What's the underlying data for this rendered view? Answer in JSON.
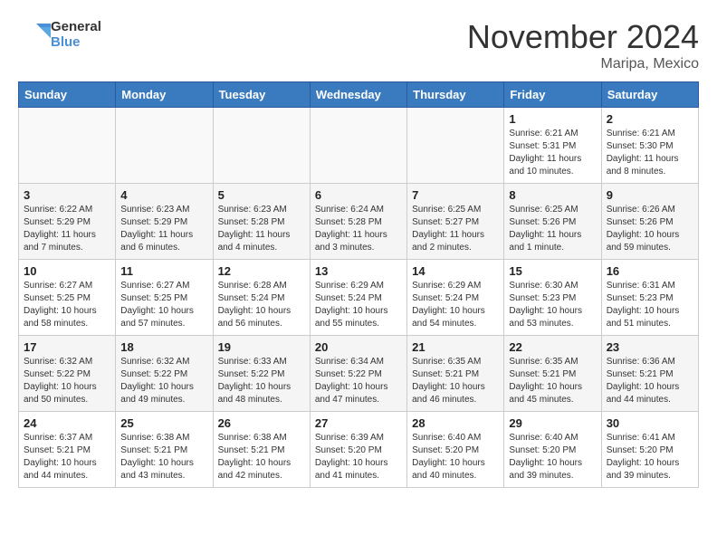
{
  "logo": {
    "line1": "General",
    "line2": "Blue"
  },
  "title": "November 2024",
  "location": "Maripa, Mexico",
  "weekdays": [
    "Sunday",
    "Monday",
    "Tuesday",
    "Wednesday",
    "Thursday",
    "Friday",
    "Saturday"
  ],
  "weeks": [
    [
      {
        "day": "",
        "info": ""
      },
      {
        "day": "",
        "info": ""
      },
      {
        "day": "",
        "info": ""
      },
      {
        "day": "",
        "info": ""
      },
      {
        "day": "",
        "info": ""
      },
      {
        "day": "1",
        "info": "Sunrise: 6:21 AM\nSunset: 5:31 PM\nDaylight: 11 hours and 10 minutes."
      },
      {
        "day": "2",
        "info": "Sunrise: 6:21 AM\nSunset: 5:30 PM\nDaylight: 11 hours and 8 minutes."
      }
    ],
    [
      {
        "day": "3",
        "info": "Sunrise: 6:22 AM\nSunset: 5:29 PM\nDaylight: 11 hours and 7 minutes."
      },
      {
        "day": "4",
        "info": "Sunrise: 6:23 AM\nSunset: 5:29 PM\nDaylight: 11 hours and 6 minutes."
      },
      {
        "day": "5",
        "info": "Sunrise: 6:23 AM\nSunset: 5:28 PM\nDaylight: 11 hours and 4 minutes."
      },
      {
        "day": "6",
        "info": "Sunrise: 6:24 AM\nSunset: 5:28 PM\nDaylight: 11 hours and 3 minutes."
      },
      {
        "day": "7",
        "info": "Sunrise: 6:25 AM\nSunset: 5:27 PM\nDaylight: 11 hours and 2 minutes."
      },
      {
        "day": "8",
        "info": "Sunrise: 6:25 AM\nSunset: 5:26 PM\nDaylight: 11 hours and 1 minute."
      },
      {
        "day": "9",
        "info": "Sunrise: 6:26 AM\nSunset: 5:26 PM\nDaylight: 10 hours and 59 minutes."
      }
    ],
    [
      {
        "day": "10",
        "info": "Sunrise: 6:27 AM\nSunset: 5:25 PM\nDaylight: 10 hours and 58 minutes."
      },
      {
        "day": "11",
        "info": "Sunrise: 6:27 AM\nSunset: 5:25 PM\nDaylight: 10 hours and 57 minutes."
      },
      {
        "day": "12",
        "info": "Sunrise: 6:28 AM\nSunset: 5:24 PM\nDaylight: 10 hours and 56 minutes."
      },
      {
        "day": "13",
        "info": "Sunrise: 6:29 AM\nSunset: 5:24 PM\nDaylight: 10 hours and 55 minutes."
      },
      {
        "day": "14",
        "info": "Sunrise: 6:29 AM\nSunset: 5:24 PM\nDaylight: 10 hours and 54 minutes."
      },
      {
        "day": "15",
        "info": "Sunrise: 6:30 AM\nSunset: 5:23 PM\nDaylight: 10 hours and 53 minutes."
      },
      {
        "day": "16",
        "info": "Sunrise: 6:31 AM\nSunset: 5:23 PM\nDaylight: 10 hours and 51 minutes."
      }
    ],
    [
      {
        "day": "17",
        "info": "Sunrise: 6:32 AM\nSunset: 5:22 PM\nDaylight: 10 hours and 50 minutes."
      },
      {
        "day": "18",
        "info": "Sunrise: 6:32 AM\nSunset: 5:22 PM\nDaylight: 10 hours and 49 minutes."
      },
      {
        "day": "19",
        "info": "Sunrise: 6:33 AM\nSunset: 5:22 PM\nDaylight: 10 hours and 48 minutes."
      },
      {
        "day": "20",
        "info": "Sunrise: 6:34 AM\nSunset: 5:22 PM\nDaylight: 10 hours and 47 minutes."
      },
      {
        "day": "21",
        "info": "Sunrise: 6:35 AM\nSunset: 5:21 PM\nDaylight: 10 hours and 46 minutes."
      },
      {
        "day": "22",
        "info": "Sunrise: 6:35 AM\nSunset: 5:21 PM\nDaylight: 10 hours and 45 minutes."
      },
      {
        "day": "23",
        "info": "Sunrise: 6:36 AM\nSunset: 5:21 PM\nDaylight: 10 hours and 44 minutes."
      }
    ],
    [
      {
        "day": "24",
        "info": "Sunrise: 6:37 AM\nSunset: 5:21 PM\nDaylight: 10 hours and 44 minutes."
      },
      {
        "day": "25",
        "info": "Sunrise: 6:38 AM\nSunset: 5:21 PM\nDaylight: 10 hours and 43 minutes."
      },
      {
        "day": "26",
        "info": "Sunrise: 6:38 AM\nSunset: 5:21 PM\nDaylight: 10 hours and 42 minutes."
      },
      {
        "day": "27",
        "info": "Sunrise: 6:39 AM\nSunset: 5:20 PM\nDaylight: 10 hours and 41 minutes."
      },
      {
        "day": "28",
        "info": "Sunrise: 6:40 AM\nSunset: 5:20 PM\nDaylight: 10 hours and 40 minutes."
      },
      {
        "day": "29",
        "info": "Sunrise: 6:40 AM\nSunset: 5:20 PM\nDaylight: 10 hours and 39 minutes."
      },
      {
        "day": "30",
        "info": "Sunrise: 6:41 AM\nSunset: 5:20 PM\nDaylight: 10 hours and 39 minutes."
      }
    ]
  ]
}
